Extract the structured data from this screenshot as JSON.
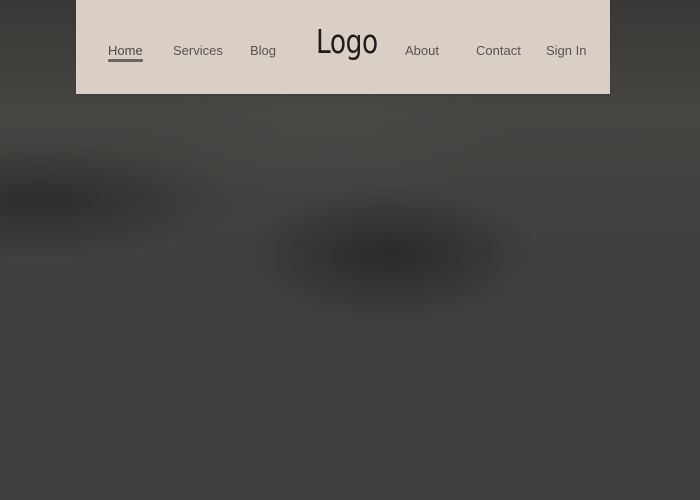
{
  "nav": {
    "logo": "Logo",
    "items": [
      {
        "label": "Home",
        "active": true
      },
      {
        "label": "Services",
        "active": false
      },
      {
        "label": "Blog",
        "active": false
      },
      {
        "label": "About",
        "active": false
      },
      {
        "label": "Contact",
        "active": false
      },
      {
        "label": "Sign In",
        "active": false
      }
    ]
  },
  "colors": {
    "navbar_background": "#d9cfc5",
    "nav_text": "#5a5250",
    "active_underline": "#6e6263",
    "logo_text": "#1f1b1b",
    "page_background": "#404241"
  }
}
